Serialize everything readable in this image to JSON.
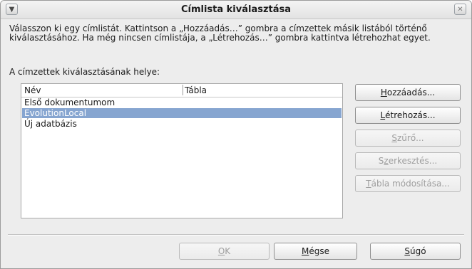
{
  "window": {
    "title": "Címlista kiválasztása"
  },
  "description": "Válasszon ki egy címlistát. Kattintson a „Hozzáadás…” gombra a címzettek másik listából történő kiválasztásához. Ha még nincsen címlistája, a „Létrehozás…” gombra kattintva létrehozhat egyet.",
  "location_label": "A címzettek kiválasztásának helye:",
  "list": {
    "columns": [
      "Név",
      "Tábla"
    ],
    "rows": [
      {
        "name": "Első dokumentumom",
        "table": "",
        "selected": false
      },
      {
        "name": "EvolutionLocal",
        "table": "",
        "selected": true
      },
      {
        "name": "Új adatbázis",
        "table": "",
        "selected": false
      }
    ]
  },
  "side_buttons": {
    "add": {
      "pre": "",
      "mnemonic": "H",
      "post": "ozzáadás...",
      "enabled": true
    },
    "create": {
      "pre": "",
      "mnemonic": "L",
      "post": "étrehozás...",
      "enabled": true
    },
    "filter": {
      "pre": "",
      "mnemonic": "S",
      "post": "zűrő...",
      "enabled": false
    },
    "edit": {
      "pre": "S",
      "mnemonic": "z",
      "post": "erkesztés...",
      "enabled": false
    },
    "change_table": {
      "pre": "",
      "mnemonic": "T",
      "post": "ábla módosítása...",
      "enabled": false
    }
  },
  "footer_buttons": {
    "ok": {
      "pre": "",
      "mnemonic": "O",
      "post": "K",
      "enabled": false
    },
    "cancel": {
      "pre": "",
      "mnemonic": "M",
      "post": "égse",
      "enabled": true
    },
    "help": {
      "pre": "",
      "mnemonic": "S",
      "post": "úgó",
      "enabled": true
    }
  },
  "colors": {
    "selection": "#86a5d0",
    "window_bg": "#ededed",
    "disabled_text": "#9e9e9e"
  },
  "icons": {
    "menu": "chevron-down-icon",
    "close": "close-icon"
  }
}
